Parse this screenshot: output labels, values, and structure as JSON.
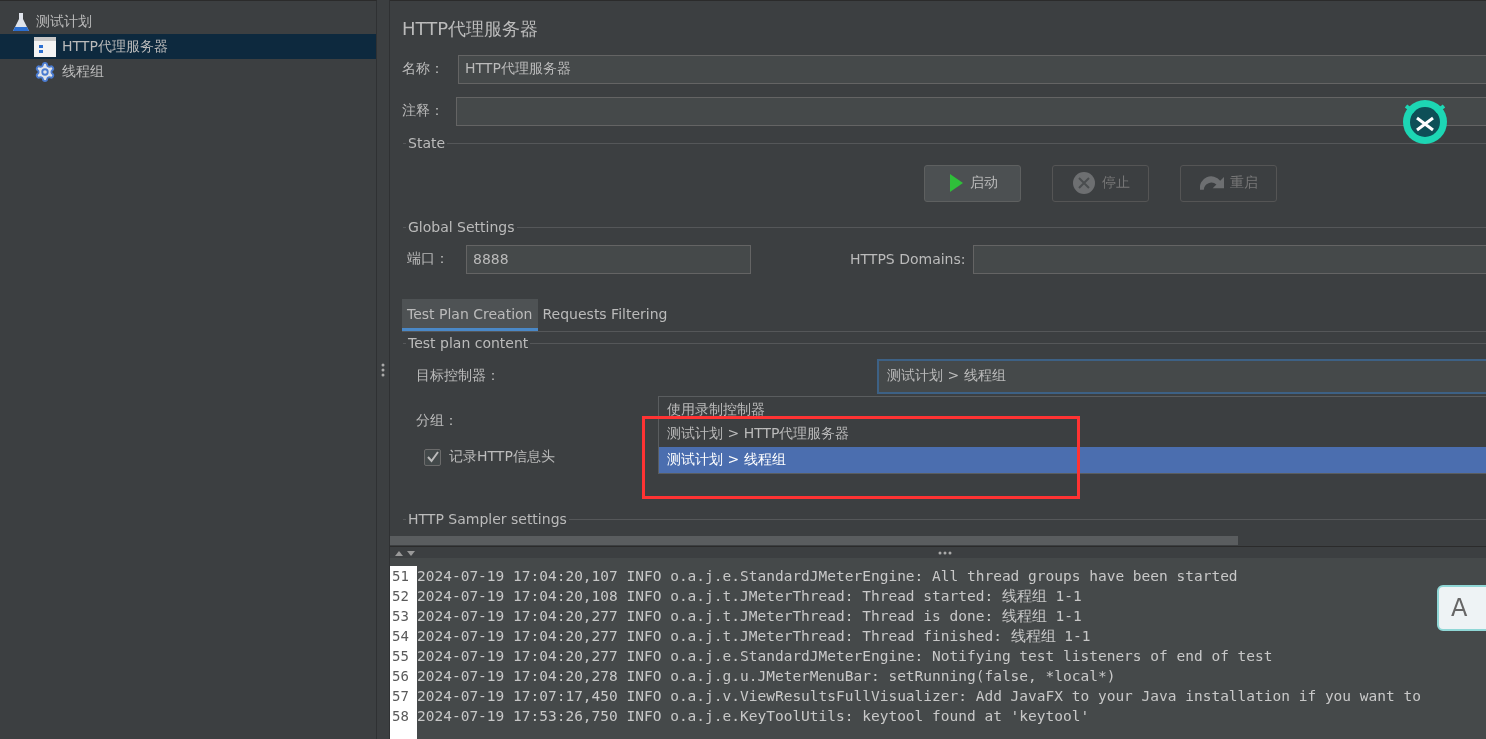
{
  "tree": [
    {
      "label": "测试计划",
      "kind": "plan",
      "selected": false,
      "children": [
        {
          "label": "HTTP代理服务器",
          "kind": "proxy",
          "selected": true
        },
        {
          "label": "线程组",
          "kind": "threadgroup",
          "selected": false
        }
      ]
    }
  ],
  "title": "HTTP代理服务器",
  "name_field": {
    "label": "名称：",
    "value": "HTTP代理服务器"
  },
  "comment_field": {
    "label": "注释："
  },
  "state": {
    "title": "State",
    "buttons": [
      {
        "label": "启动",
        "kind": "start",
        "disabled": false
      },
      {
        "label": "停止",
        "kind": "stop",
        "disabled": true
      },
      {
        "label": "重启",
        "kind": "restart",
        "disabled": true
      }
    ]
  },
  "global": {
    "title": "Global Settings",
    "port_label": "端口：",
    "port": "8888",
    "https_label": "HTTPS Domains:"
  },
  "tabs": [
    {
      "label": "Test Plan Creation",
      "selected": true
    },
    {
      "label": "Requests Filtering",
      "selected": false
    }
  ],
  "content": {
    "title": "Test plan content",
    "target_label": "目标控制器：",
    "target_value": "测试计划 > 线程组",
    "group_label": "分组：",
    "record_headers": {
      "label": "记录HTTP信息头",
      "checked": true
    }
  },
  "dropdown": [
    {
      "label": "使用录制控制器",
      "selected": false
    },
    {
      "label": "测试计划 > HTTP代理服务器",
      "selected": false
    },
    {
      "label": "测试计划 > 线程组",
      "selected": true
    }
  ],
  "sampler_title": "HTTP Sampler settings",
  "log": [
    {
      "line": "51",
      "text": "2024-07-19 17:04:20,107 INFO o.a.j.e.StandardJMeterEngine: All thread groups have been started"
    },
    {
      "line": "52",
      "text": "2024-07-19 17:04:20,108 INFO o.a.j.t.JMeterThread: Thread started: 线程组 1-1"
    },
    {
      "line": "53",
      "text": "2024-07-19 17:04:20,277 INFO o.a.j.t.JMeterThread: Thread is done: 线程组 1-1"
    },
    {
      "line": "54",
      "text": "2024-07-19 17:04:20,277 INFO o.a.j.t.JMeterThread: Thread finished: 线程组 1-1"
    },
    {
      "line": "55",
      "text": "2024-07-19 17:04:20,277 INFO o.a.j.e.StandardJMeterEngine: Notifying test listeners of end of test"
    },
    {
      "line": "56",
      "text": "2024-07-19 17:04:20,278 INFO o.a.j.g.u.JMeterMenuBar: setRunning(false, *local*)"
    },
    {
      "line": "57",
      "text": "2024-07-19 17:07:17,450 INFO o.a.j.v.ViewResultsFullVisualizer: Add JavaFX to your Java installation if you want to"
    },
    {
      "line": "58",
      "text": "2024-07-19 17:53:26,750 INFO o.a.j.e.KeyToolUtils: keytool found at 'keytool'"
    }
  ],
  "float_button": "A"
}
